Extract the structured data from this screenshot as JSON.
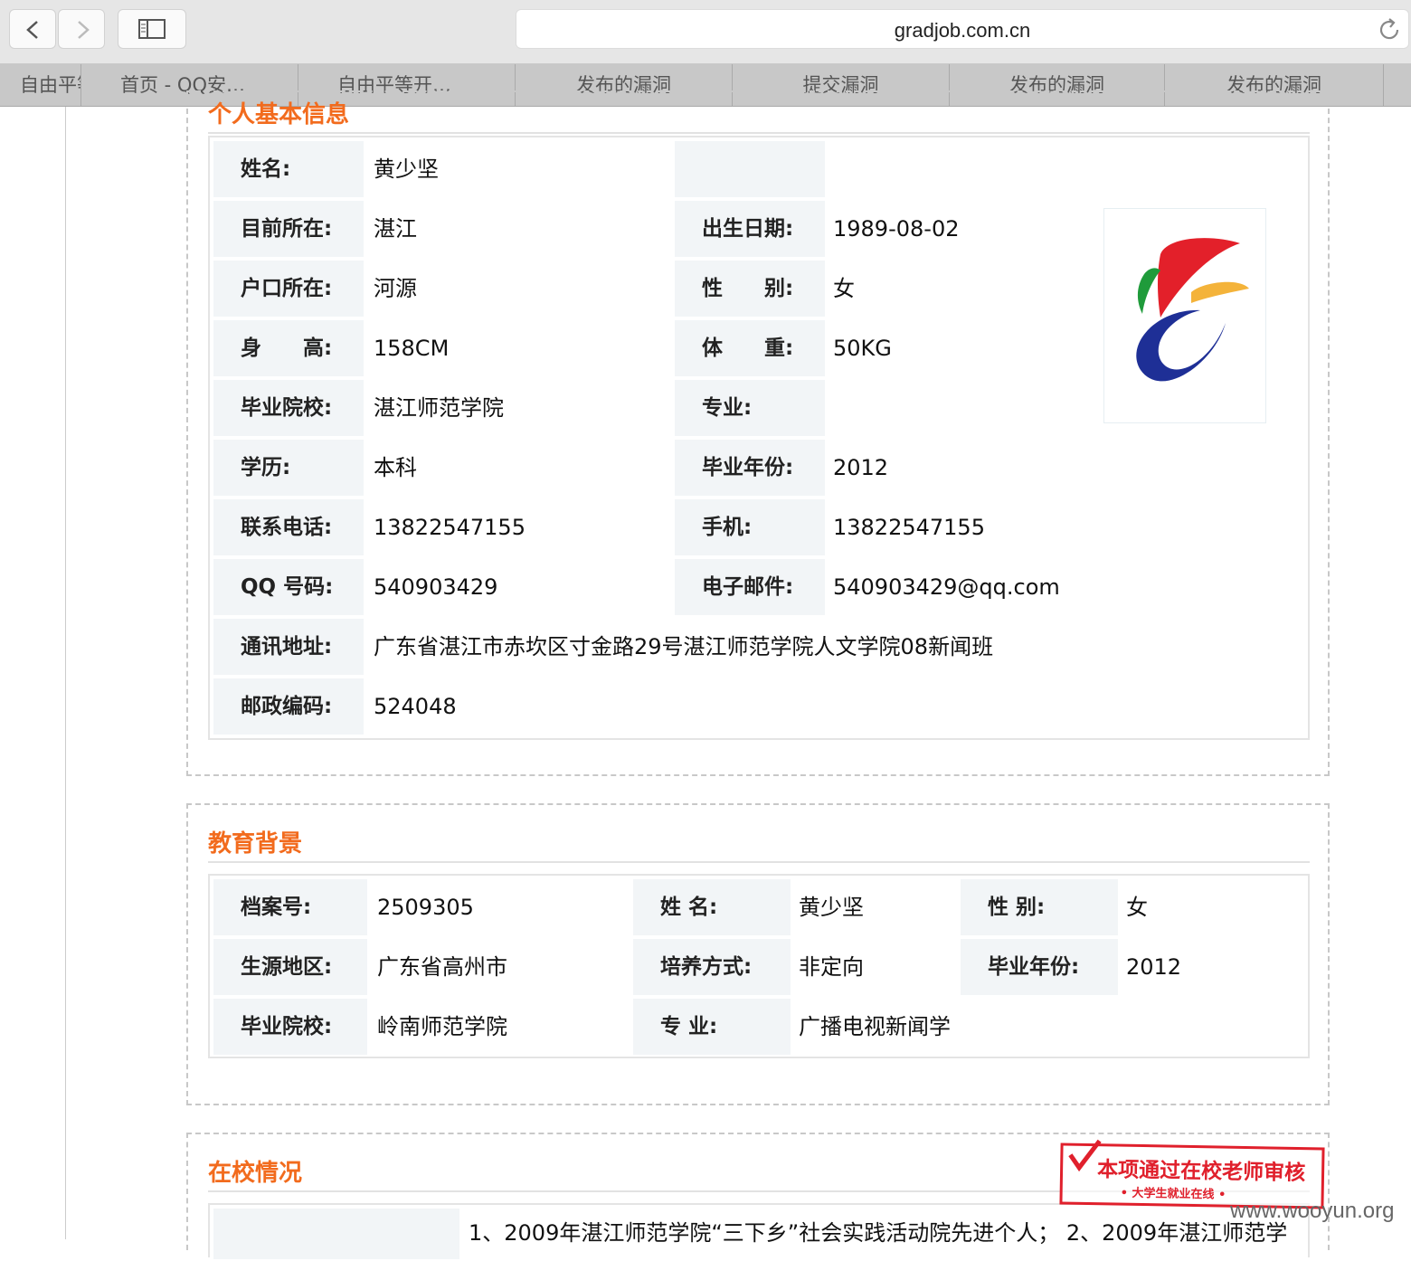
{
  "browser": {
    "url": "gradjob.com.cn",
    "tabs": [
      "自由平等开…",
      "首页 - QQ安…",
      "自由平等开…",
      "发布的漏洞",
      "提交漏洞",
      "发布的漏洞",
      "发布的漏洞"
    ]
  },
  "personal": {
    "title": "个人基本信息",
    "rows": [
      {
        "label": "姓名:",
        "value": "黄少坚",
        "label2": "",
        "value2": ""
      },
      {
        "label": "目前所在:",
        "value": "湛江",
        "label2": "出生日期:",
        "value2": "1989-08-02"
      },
      {
        "label": "户口所在:",
        "value": "河源",
        "label2": "性　　别:",
        "value2": "女"
      },
      {
        "label": "身　　高:",
        "value": "158CM",
        "label2": "体　　重:",
        "value2": "50KG"
      },
      {
        "label": "毕业院校:",
        "value": "湛江师范学院",
        "label2": "专业:",
        "value2": ""
      },
      {
        "label": "学历:",
        "value": "本科",
        "label2": "毕业年份:",
        "value2": "2012"
      },
      {
        "label": "联系电话:",
        "value": "13822547155",
        "label2": "手机:",
        "value2": "13822547155"
      },
      {
        "label": "QQ 号码:",
        "value": "540903429",
        "label2": "电子邮件:",
        "value2": "540903429@qq.com"
      },
      {
        "label": "通讯地址:",
        "value": "广东省湛江市赤坎区寸金路29号湛江师范学院人文学院08新闻班"
      },
      {
        "label": "邮政编码:",
        "value": "524048"
      }
    ]
  },
  "education": {
    "title": "教育背景",
    "rows": [
      [
        {
          "label": "档案号:",
          "value": "2509305"
        },
        {
          "label": "姓 名:",
          "value": "黄少坚"
        },
        {
          "label": "性 别:",
          "value": "女"
        }
      ],
      [
        {
          "label": "生源地区:",
          "value": "广东省高州市"
        },
        {
          "label": "培养方式:",
          "value": "非定向"
        },
        {
          "label": "毕业年份:",
          "value": "2012"
        }
      ],
      [
        {
          "label": "毕业院校:",
          "value": "岭南师范学院"
        },
        {
          "label": "专 业:",
          "value": "广播电视新闻学"
        }
      ]
    ]
  },
  "school": {
    "title": "在校情况",
    "text": "1、2009年湛江师范学院“三下乡”社会实践活动院先进个人；  2、2009年湛江师范学"
  },
  "stamp": {
    "main": "本项通过在校老师审核",
    "sub": "• 大学生就业在线 •"
  },
  "watermark": "www.wooyun.org",
  "colors": {
    "accent": "#f26b1d",
    "label_bg": "#f2f5f7",
    "stamp": "#e0202c"
  }
}
